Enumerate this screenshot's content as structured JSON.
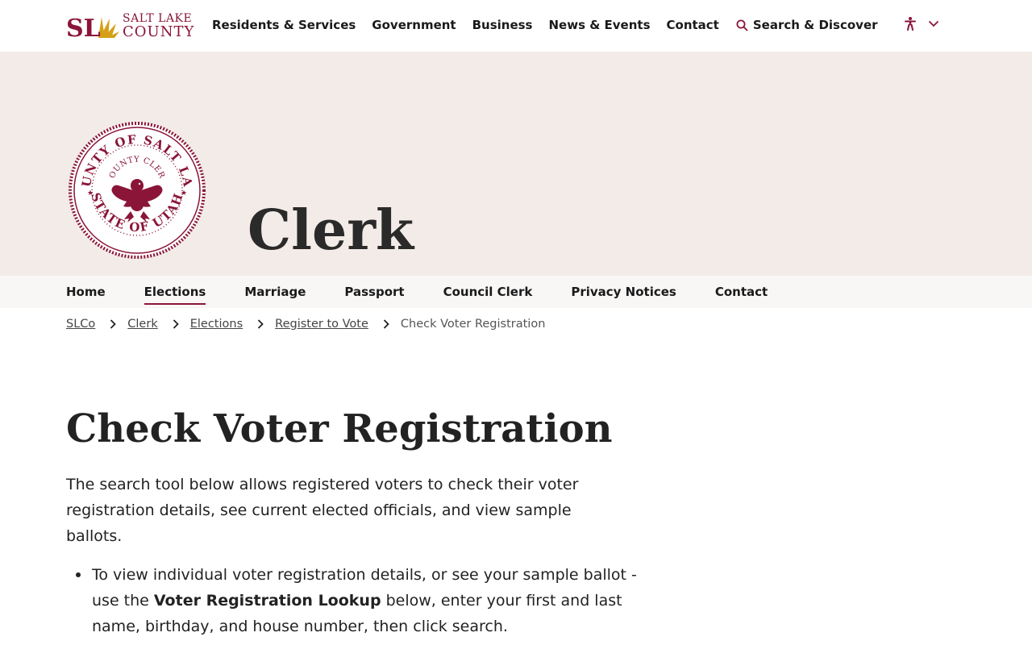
{
  "header": {
    "logo_line1": "SALT LAKE",
    "logo_line2": "COUNTY",
    "logo_mark": "SL",
    "nav": [
      {
        "label": "Residents & Services"
      },
      {
        "label": "Government"
      },
      {
        "label": "Business"
      },
      {
        "label": "News & Events"
      },
      {
        "label": "Contact"
      },
      {
        "label": "Search & Discover"
      }
    ]
  },
  "hero": {
    "title": "Clerk",
    "seal_outer_text": "COUNTY OF SALT LAKE",
    "seal_lower_text": "STATE OF UTAH",
    "seal_inner_text": "COUNTY CLERK"
  },
  "subnav": {
    "items": [
      {
        "label": "Home"
      },
      {
        "label": "Elections"
      },
      {
        "label": "Marriage"
      },
      {
        "label": "Passport"
      },
      {
        "label": "Council Clerk"
      },
      {
        "label": "Privacy Notices"
      },
      {
        "label": "Contact"
      }
    ]
  },
  "breadcrumb": {
    "items": [
      {
        "label": "SLCo"
      },
      {
        "label": "Clerk"
      },
      {
        "label": "Elections"
      },
      {
        "label": "Register to Vote"
      }
    ],
    "current": "Check Voter Registration"
  },
  "main": {
    "title": "Check Voter Registration",
    "intro": "The search tool below allows registered voters to check their voter registration details, see current elected officials, and view sample ballots.",
    "bullet1_before": "To view individual voter registration details, or see your sample ballot - use the ",
    "bullet1_bold": "Voter Registration Lookup",
    "bullet1_after": " below, enter your first and last name, birthday, and house number, then click search."
  },
  "colors": {
    "brand": "#8a1538",
    "gold": "#d4a017",
    "hero_bg": "#f3ebe7"
  }
}
